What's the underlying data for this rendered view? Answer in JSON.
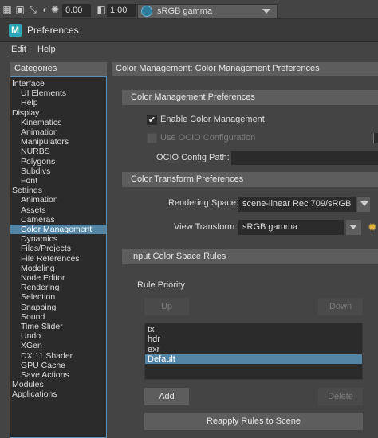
{
  "toolbar": {
    "exposure_value": "0.00",
    "gamma_value": "1.00",
    "view_transform": "sRGB gamma"
  },
  "window": {
    "title": "Preferences",
    "menu": [
      "Edit",
      "Help"
    ]
  },
  "categories": {
    "header": "Categories",
    "items": [
      {
        "label": "Interface",
        "level": 0
      },
      {
        "label": "UI Elements",
        "level": 1
      },
      {
        "label": "Help",
        "level": 1
      },
      {
        "label": "Display",
        "level": 0
      },
      {
        "label": "Kinematics",
        "level": 1
      },
      {
        "label": "Animation",
        "level": 1
      },
      {
        "label": "Manipulators",
        "level": 1
      },
      {
        "label": "NURBS",
        "level": 1
      },
      {
        "label": "Polygons",
        "level": 1
      },
      {
        "label": "Subdivs",
        "level": 1
      },
      {
        "label": "Font",
        "level": 1
      },
      {
        "label": "Settings",
        "level": 0
      },
      {
        "label": "Animation",
        "level": 1
      },
      {
        "label": "Assets",
        "level": 1
      },
      {
        "label": "Cameras",
        "level": 1
      },
      {
        "label": "Color Management",
        "level": 1,
        "selected": true
      },
      {
        "label": "Dynamics",
        "level": 1
      },
      {
        "label": "Files/Projects",
        "level": 1
      },
      {
        "label": "File References",
        "level": 1
      },
      {
        "label": "Modeling",
        "level": 1
      },
      {
        "label": "Node Editor",
        "level": 1
      },
      {
        "label": "Rendering",
        "level": 1
      },
      {
        "label": "Selection",
        "level": 1
      },
      {
        "label": "Snapping",
        "level": 1
      },
      {
        "label": "Sound",
        "level": 1
      },
      {
        "label": "Time Slider",
        "level": 1
      },
      {
        "label": "Undo",
        "level": 1
      },
      {
        "label": "XGen",
        "level": 1
      },
      {
        "label": "DX 11 Shader",
        "level": 1
      },
      {
        "label": "GPU Cache",
        "level": 1
      },
      {
        "label": "Save Actions",
        "level": 1
      },
      {
        "label": "Modules",
        "level": 0
      },
      {
        "label": "Applications",
        "level": 0
      }
    ]
  },
  "main": {
    "header": "Color Management: Color Management Preferences",
    "cm_section": {
      "title": "Color Management Preferences",
      "enable_label": "Enable Color Management",
      "enable_checked": true,
      "ocio_label": "Use OCIO Configuration",
      "ocio_checked": false,
      "config_path_label": "OCIO Config Path:",
      "config_path_value": ""
    },
    "ct_section": {
      "title": "Color Transform Preferences",
      "rendering_space_label": "Rendering Space:",
      "rendering_space_value": "scene-linear Rec 709/sRGB",
      "view_transform_label": "View Transform:",
      "view_transform_value": "sRGB gamma"
    },
    "rules_section": {
      "title": "Input Color Space Rules",
      "priority_label": "Rule Priority",
      "up_label": "Up",
      "down_label": "Down",
      "rules": [
        "tx",
        "hdr",
        "exr",
        "Default"
      ],
      "selected_rule": "Default",
      "add_label": "Add",
      "delete_label": "Delete",
      "reapply_label": "Reapply Rules to Scene"
    }
  }
}
